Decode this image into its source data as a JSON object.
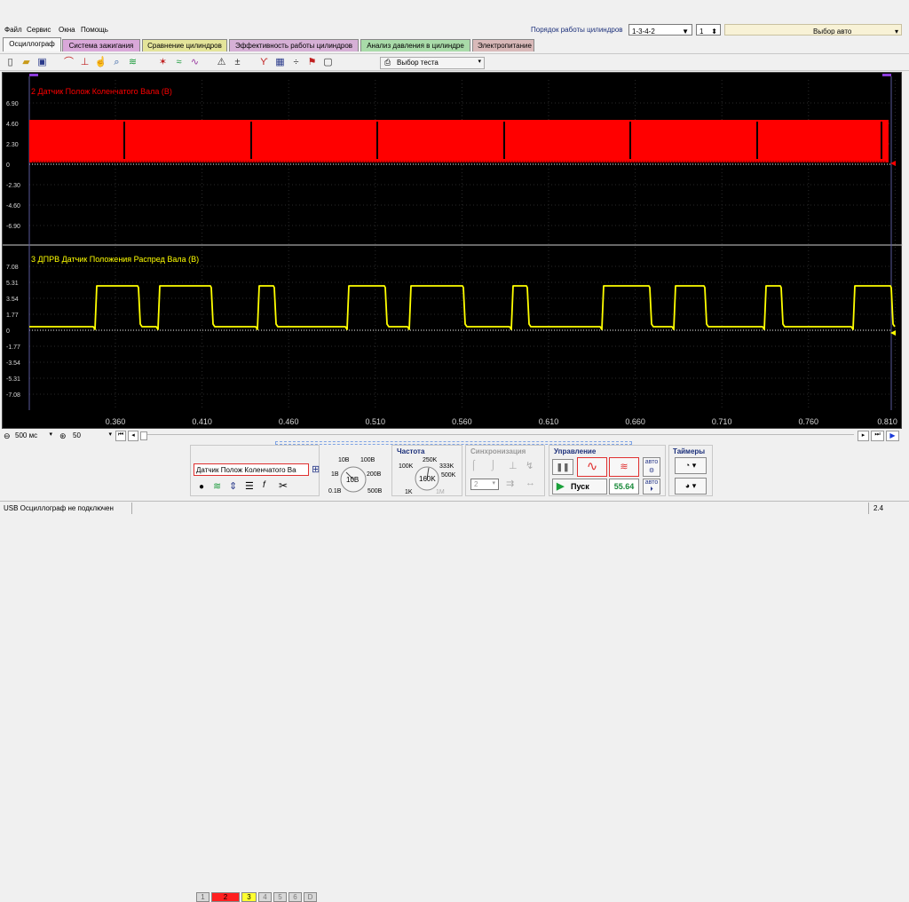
{
  "menu": {
    "items": [
      "Файл",
      "Сервис",
      "Окна",
      "Помощь"
    ],
    "cyl_order_label": "Порядок работы цилиндров",
    "cyl_order_value": "1-3-4-2",
    "cyl_number": "1",
    "auto_select": "Выбор авто"
  },
  "tabs": [
    {
      "label": "Осциллограф",
      "color": "#f0f0f0"
    },
    {
      "label": "Система зажигания",
      "color": "#d9a8d9"
    },
    {
      "label": "Сравнение цилиндров",
      "color": "#e4e49a"
    },
    {
      "label": "Эффективность работы цилиндров",
      "color": "#d6b0d6"
    },
    {
      "label": "Анализ давления в цилиндре",
      "color": "#a9dba9"
    },
    {
      "label": "Электропитание",
      "color": "#d9b9b9"
    }
  ],
  "toolbar": {
    "test_select": "Выбор теста"
  },
  "scope": {
    "ch2": {
      "title": "2 Датчик Полож Коленчатого Вала (В)",
      "color": "#ff0000",
      "yticks": [
        "6.90",
        "4.60",
        "2.30",
        "0",
        "-2.30",
        "-4.60",
        "-6.90"
      ]
    },
    "ch3": {
      "title": "3 ДПРВ Датчик Положения Распред Вала (В)",
      "color": "#ffff00",
      "yticks": [
        "7.08",
        "5.31",
        "3.54",
        "1.77",
        "0",
        "-1.77",
        "-3.54",
        "-5.31",
        "-7.08"
      ]
    },
    "xticks": [
      "0.360",
      "0.410",
      "0.460",
      "0.510",
      "0.560",
      "0.610",
      "0.660",
      "0.710",
      "0.760",
      "0.810"
    ]
  },
  "controls": {
    "timebase": "500 мс",
    "zoom": "50",
    "channels": [
      "1",
      "2",
      "3",
      "4",
      "5",
      "6",
      "D"
    ],
    "channel_name": "Датчик Полож Коленчатого Ва",
    "volt_labels": [
      "10В",
      "100В",
      "1В",
      "200В",
      "0.1В",
      "500В"
    ],
    "volt_value": "10В",
    "freq_title": "Частота",
    "freq_labels": [
      "250K",
      "100K",
      "333K",
      "500K",
      "1K",
      "1M"
    ],
    "freq_value": "160K",
    "sync_title": "Синхронизация",
    "sync_value": "2",
    "control_title": "Управление",
    "auto_label": "авто",
    "start_label": "Пуск",
    "counter": "55.64",
    "timers_title": "Таймеры"
  },
  "status": {
    "text": "USB Осциллограф не подключен",
    "right": "2.4"
  }
}
